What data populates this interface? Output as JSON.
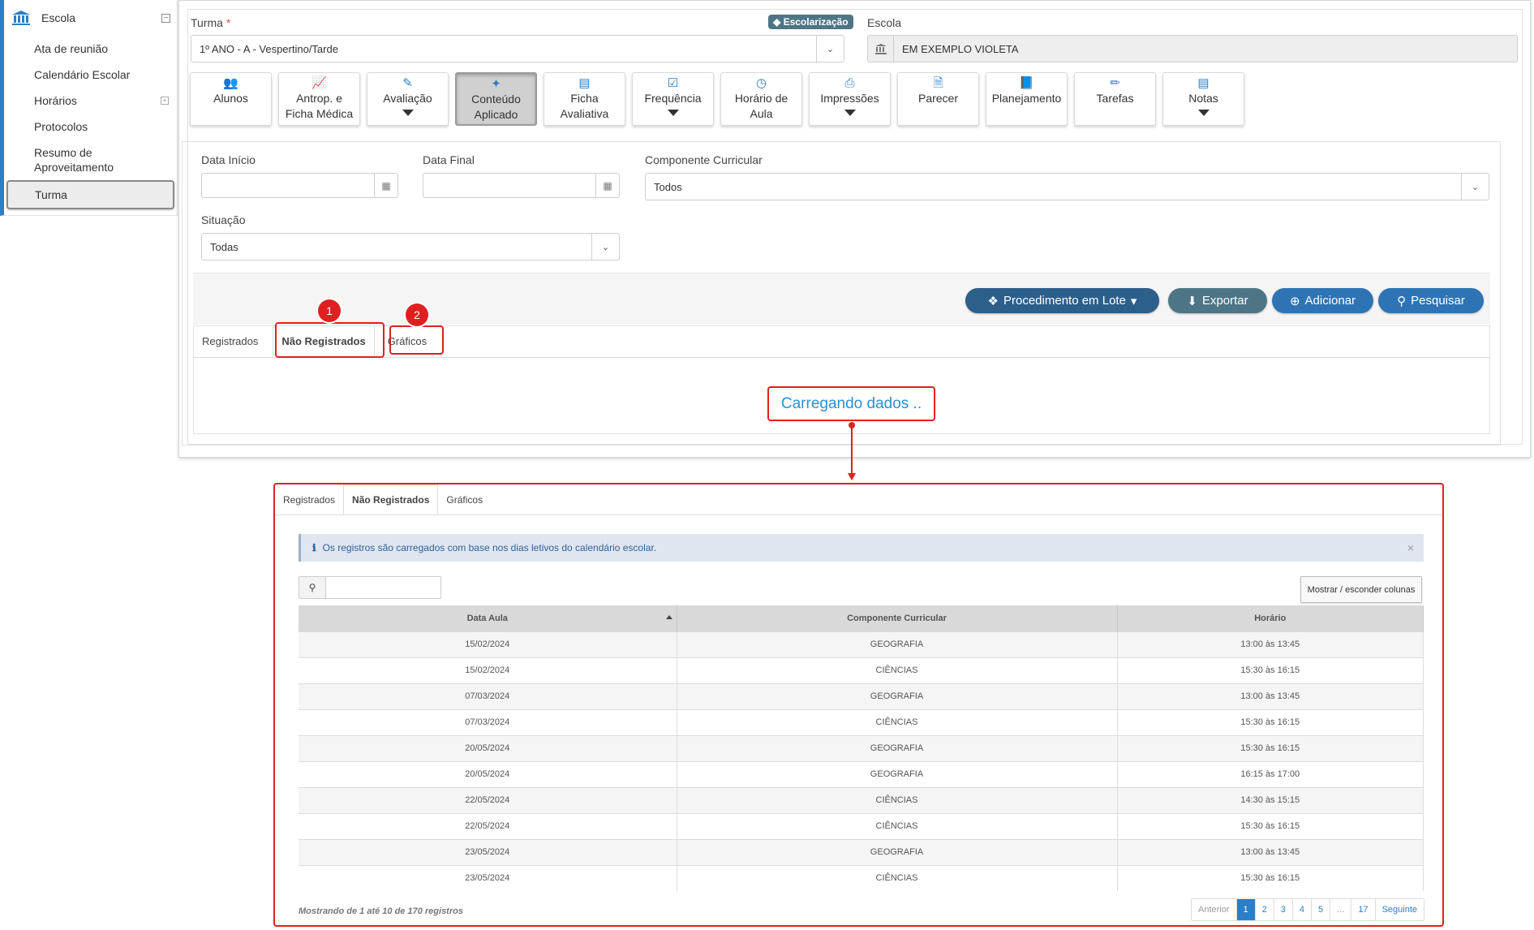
{
  "sidebar": {
    "title": "Escola",
    "items": [
      {
        "label": "Ata de reunião"
      },
      {
        "label": "Calendário Escolar"
      },
      {
        "label": "Horários"
      },
      {
        "label": "Protocolos"
      },
      {
        "label": "Resumo de Aproveitamento"
      },
      {
        "label": "Turma"
      }
    ]
  },
  "form": {
    "turma_label": "Turma",
    "turma_required": "*",
    "badge": "Escolarização",
    "turma_value": "1º ANO - A - Vespertino/Tarde",
    "escola_label": "Escola",
    "escola_value": "EM EXEMPLO VIOLETA"
  },
  "toolbar": [
    {
      "line1": "Alunos",
      "line2": "",
      "icon": "users-icon"
    },
    {
      "line1": "Antrop. e",
      "line2": "Ficha Médica",
      "icon": "chart-icon"
    },
    {
      "line1": "Avaliação",
      "line2": "",
      "icon": "edit-icon"
    },
    {
      "line1": "Conteúdo",
      "line2": "Aplicado",
      "icon": "wand-icon"
    },
    {
      "line1": "Ficha",
      "line2": "Avaliativa",
      "icon": "list-icon"
    },
    {
      "line1": "Frequência",
      "line2": "",
      "icon": "check-icon"
    },
    {
      "line1": "Horário de",
      "line2": "Aula",
      "icon": "clock-icon"
    },
    {
      "line1": "Impressões",
      "line2": "",
      "icon": "print-icon"
    },
    {
      "line1": "Parecer",
      "line2": "",
      "icon": "file-icon"
    },
    {
      "line1": "Planejamento",
      "line2": "",
      "icon": "book-icon"
    },
    {
      "line1": "Tarefas",
      "line2": "",
      "icon": "pencil-icon"
    },
    {
      "line1": "Notas",
      "line2": "",
      "icon": "list-icon"
    }
  ],
  "filters": {
    "data_inicio_label": "Data Início",
    "data_final_label": "Data Final",
    "componente_label": "Componente Curricular",
    "componente_value": "Todos",
    "situacao_label": "Situação",
    "situacao_value": "Todas"
  },
  "actions": {
    "lote": "Procedimento em Lote",
    "exportar": "Exportar",
    "adicionar": "Adicionar",
    "pesquisar": "Pesquisar"
  },
  "tabs": [
    "Registrados",
    "Não Registrados",
    "Gráficos"
  ],
  "markers": [
    "1",
    "2"
  ],
  "loading_text": "Carregando dados ..",
  "zoom": {
    "alert": "Os registros são carregados com base nos dias letivos do calendário escolar.",
    "columns_button": "Mostrar / esconder colunas",
    "headers": [
      "Data Aula",
      "Componente Curricular",
      "Horário"
    ],
    "rows": [
      [
        "15/02/2024",
        "GEOGRAFIA",
        "13:00 às 13:45"
      ],
      [
        "15/02/2024",
        "CIÊNCIAS",
        "15:30 às 16:15"
      ],
      [
        "07/03/2024",
        "GEOGRAFIA",
        "13:00 às 13:45"
      ],
      [
        "07/03/2024",
        "CIÊNCIAS",
        "15:30 às 16:15"
      ],
      [
        "20/05/2024",
        "GEOGRAFIA",
        "15:30 às 16:15"
      ],
      [
        "20/05/2024",
        "GEOGRAFIA",
        "16:15 às 17:00"
      ],
      [
        "22/05/2024",
        "CIÊNCIAS",
        "14:30 às 15:15"
      ],
      [
        "22/05/2024",
        "CIÊNCIAS",
        "15:30 às 16:15"
      ],
      [
        "23/05/2024",
        "GEOGRAFIA",
        "13:00 às 13:45"
      ],
      [
        "23/05/2024",
        "CIÊNCIAS",
        "15:30 às 16:15"
      ]
    ],
    "footer": "Mostrando de 1 até 10 de 170 registros",
    "pager": {
      "prev": "Anterior",
      "pages": [
        "1",
        "2",
        "3",
        "4",
        "5",
        "...",
        "17"
      ],
      "next": "Seguinte"
    }
  },
  "colors": {
    "accent": "#2a7fc6",
    "highlight": "#e02020",
    "button_dark": "#2d5f8b",
    "button_export": "#4d7585"
  }
}
